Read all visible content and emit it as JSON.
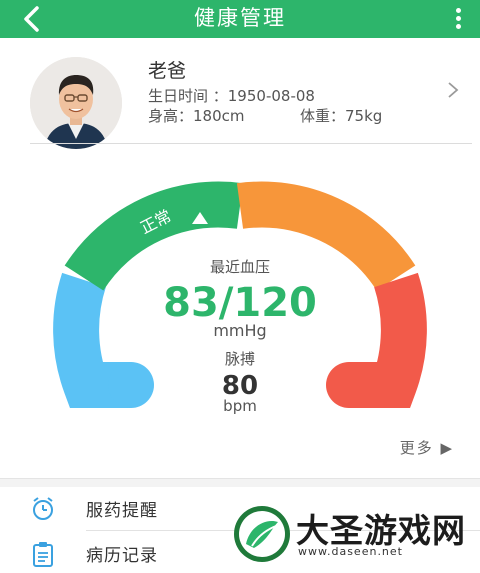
{
  "header": {
    "title": "健康管理",
    "back_icon": "chevron-left-icon",
    "menu_icon": "more-vertical-icon"
  },
  "profile": {
    "name": "老爸",
    "birthday_line": "生日时间 ：1950-08-08",
    "height_line": "身高：180cm",
    "weight_line": "体重：75kg"
  },
  "gauge": {
    "status_label": "正常",
    "bp_label": "最近血压",
    "bp_value": "83/120",
    "bp_unit": "mmHg",
    "pulse_label": "脉搏",
    "pulse_value": "80",
    "pulse_unit": "bpm",
    "colors": {
      "low": "#5bc2f5",
      "normal": "#2db56b",
      "high": "#f7963a",
      "very_high": "#f25a4a"
    }
  },
  "more_label": "更多 ▶",
  "menu": [
    {
      "label": "服药提醒",
      "icon": "alarm-clock-icon"
    },
    {
      "label": "病历记录",
      "icon": "clipboard-icon"
    }
  ],
  "watermark": {
    "name": "大圣游戏网",
    "url": "www.daseen.net"
  }
}
